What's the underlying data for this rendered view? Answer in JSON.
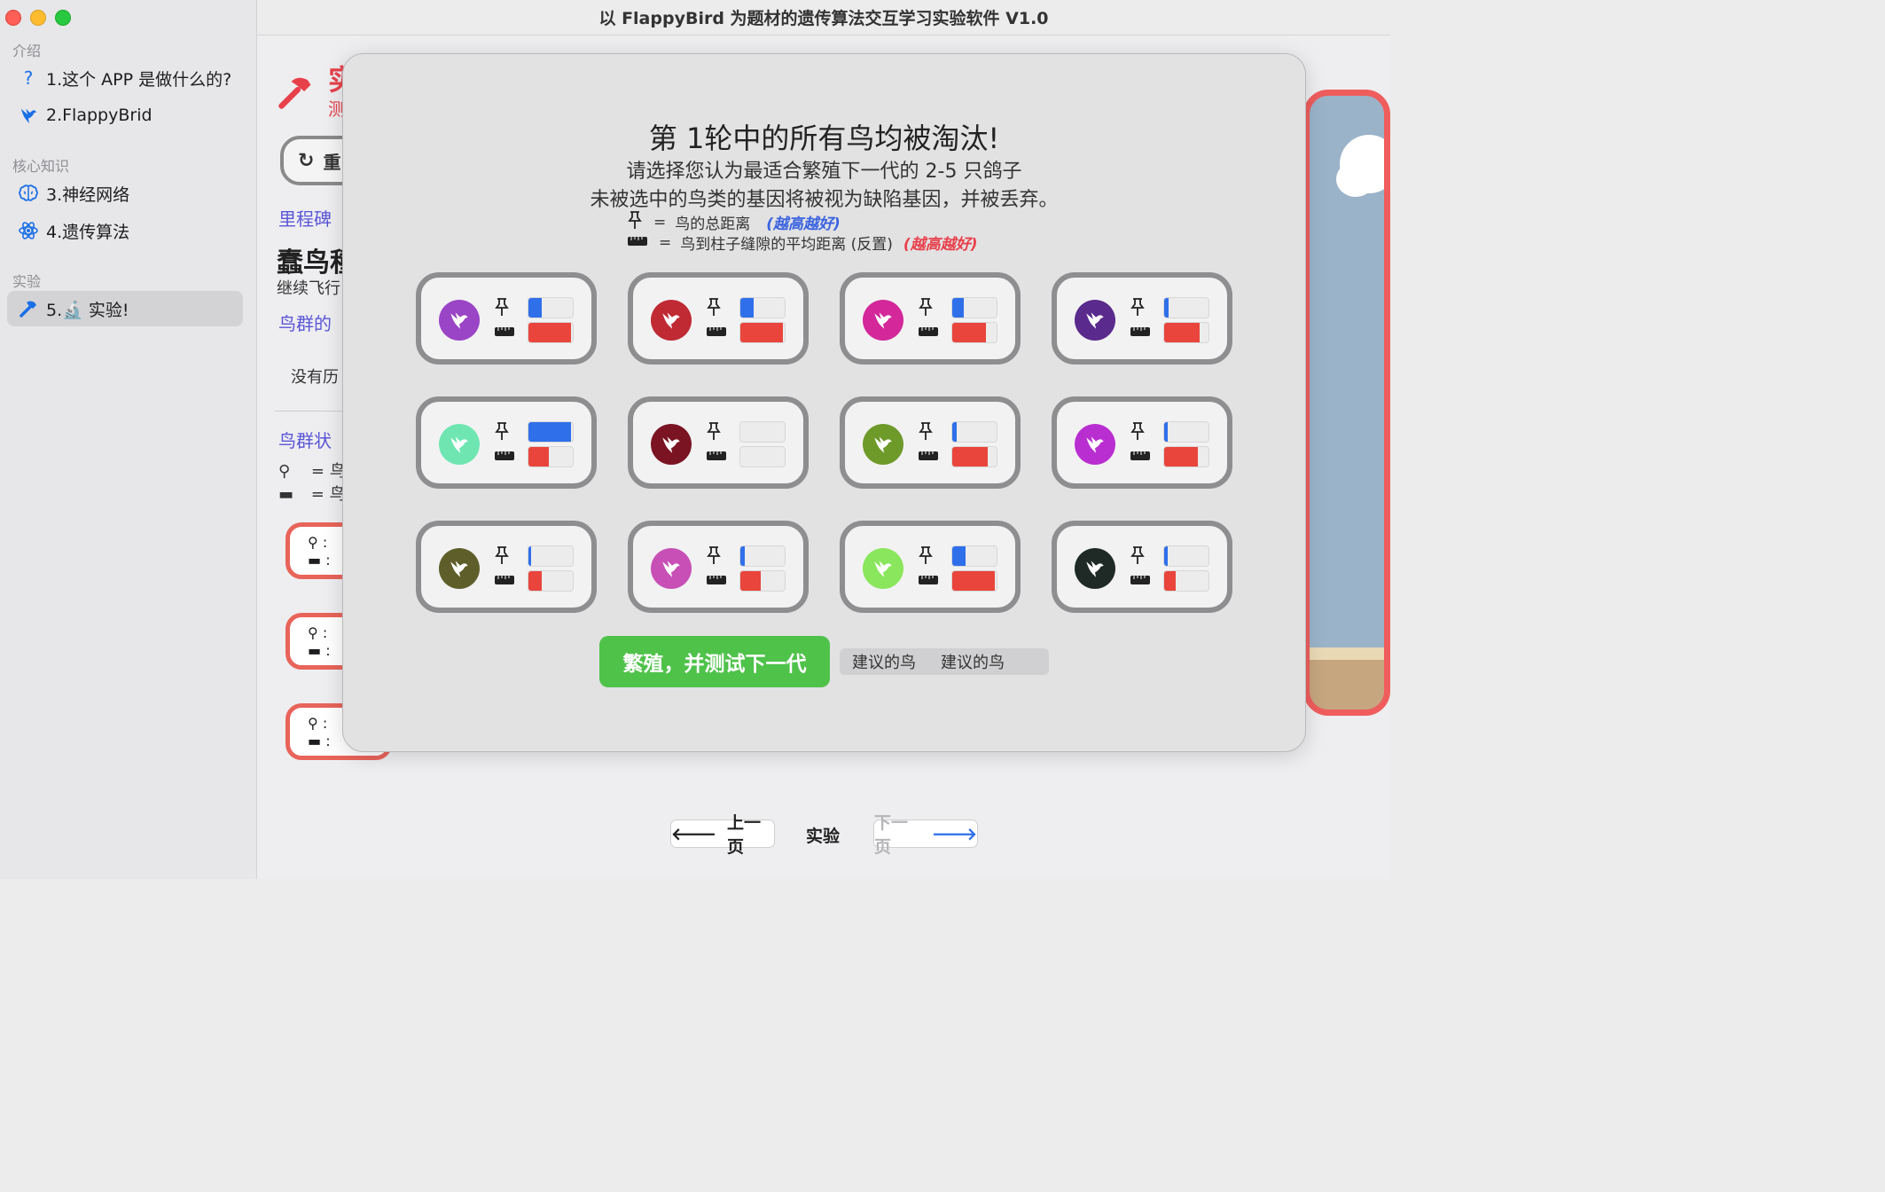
{
  "window": {
    "title": "以 FlappyBird 为题材的遗传算法交互学习实验软件 V1.0"
  },
  "sidebar": {
    "sections": [
      {
        "title": "介绍",
        "items": [
          {
            "label": "1.这个 APP 是做什么的?",
            "icon": "question-icon"
          },
          {
            "label": "2.FlappyBrid",
            "icon": "bird-icon"
          }
        ]
      },
      {
        "title": "核心知识",
        "items": [
          {
            "label": "3.神经网络",
            "icon": "brain-icon"
          },
          {
            "label": "4.遗传算法",
            "icon": "atom-icon"
          }
        ]
      },
      {
        "title": "实验",
        "items": [
          {
            "label": "5.🔬 实验!",
            "icon": "hammer-icon",
            "active": true
          }
        ]
      }
    ]
  },
  "background": {
    "title": "实",
    "subtitle": "测",
    "reset_label": "重",
    "milestone": "里程碑",
    "heading": "蠢鸟種",
    "continue": "继续飞行",
    "flock_link": "鸟群的",
    "no_history": "没有历",
    "flock_status": "鸟群状",
    "legend1": "= 鸟",
    "legend2": "= 鸟",
    "card_colon": ":"
  },
  "modal": {
    "title": "第 1轮中的所有鸟均被淘汰!",
    "line1": "请选择您认为最适合繁殖下一代的 2-5 只鸽子",
    "line2": "未被选中的鸟类的基因将被视为缺陷基因，并被丢弃。",
    "legend_distance_eq": "=",
    "legend_distance": "鸟的总距离",
    "legend_distance_note": "(越高越好)",
    "legend_gap_eq": "=",
    "legend_gap": "鸟到柱子缝隙的平均距离 (反置)",
    "legend_gap_note": "(越高越好)",
    "breed_button": "繁殖，并测试下一代",
    "suggest_1": "建议的鸟",
    "suggest_2": "建议的鸟",
    "colors": {
      "distance_bar": "#2f6fea",
      "gap_bar": "#e9453c",
      "breed_button": "#4fc24a"
    }
  },
  "birds": [
    {
      "color": "#9a44c6",
      "distance": 0.3,
      "gap": 0.95
    },
    {
      "color": "#c02a33",
      "distance": 0.3,
      "gap": 0.95
    },
    {
      "color": "#d3279a",
      "distance": 0.25,
      "gap": 0.75
    },
    {
      "color": "#5a2a8c",
      "distance": 0.1,
      "gap": 0.8
    },
    {
      "color": "#6fe6b2",
      "distance": 0.95,
      "gap": 0.45
    },
    {
      "color": "#7a1422",
      "distance": 0.0,
      "gap": 0.0
    },
    {
      "color": "#6e9a2a",
      "distance": 0.1,
      "gap": 0.8
    },
    {
      "color": "#b92ed0",
      "distance": 0.08,
      "gap": 0.75
    },
    {
      "color": "#5e5e2a",
      "distance": 0.05,
      "gap": 0.3
    },
    {
      "color": "#c74fb6",
      "distance": 0.1,
      "gap": 0.45
    },
    {
      "color": "#8ae65c",
      "distance": 0.3,
      "gap": 0.95
    },
    {
      "color": "#1f2a27",
      "distance": 0.08,
      "gap": 0.25
    }
  ],
  "nav": {
    "prev": "上一页",
    "current": "实验",
    "next": "下一页"
  }
}
